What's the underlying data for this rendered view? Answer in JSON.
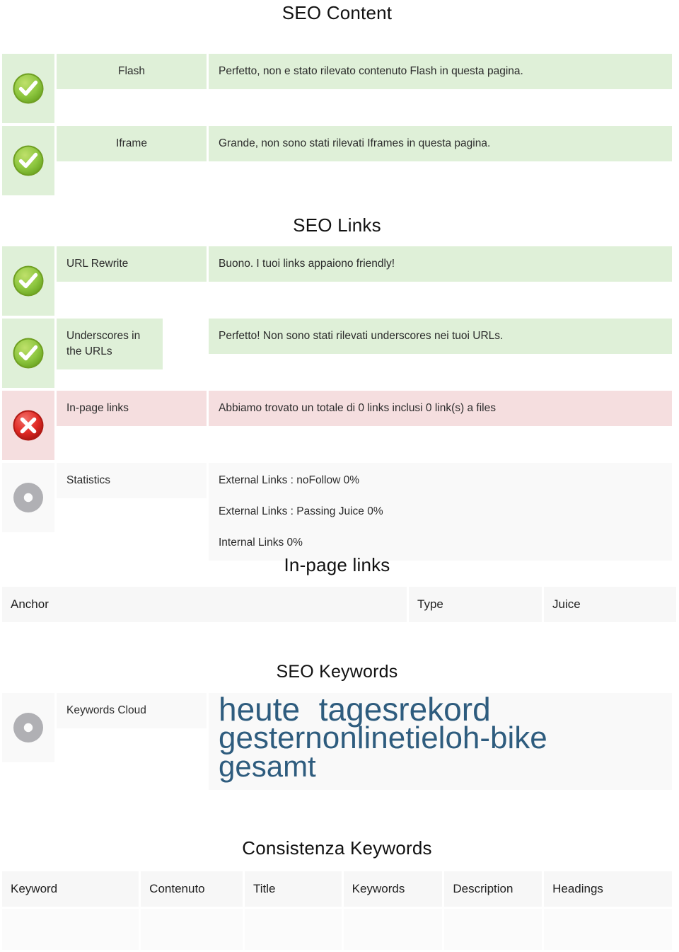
{
  "sections": {
    "seo_content": {
      "title": "SEO Content",
      "rows": [
        {
          "status": "ok",
          "icon": "green-check-icon",
          "label": "Flash",
          "text": "Perfetto, non e stato rilevato contenuto Flash in questa pagina."
        },
        {
          "status": "ok",
          "icon": "green-check-icon",
          "label": "Iframe",
          "text": "Grande, non sono stati rilevati Iframes in questa pagina."
        }
      ]
    },
    "seo_links": {
      "title": "SEO Links",
      "rows": [
        {
          "status": "ok",
          "icon": "green-check-icon",
          "label": "URL Rewrite",
          "text": "Buono. I tuoi links appaiono friendly!"
        },
        {
          "status": "ok",
          "icon": "green-check-icon",
          "label": "Underscores in the URLs",
          "text": "Perfetto! Non sono stati rilevati underscores nei tuoi URLs."
        },
        {
          "status": "error",
          "icon": "red-cross-icon",
          "label": "In-page links",
          "text": "Abbiamo trovato un totale di 0 links inclusi 0 link(s) a files"
        }
      ],
      "statistics": {
        "status": "info",
        "icon": "gray-donut-icon",
        "label": "Statistics",
        "lines": [
          "External Links : noFollow 0%",
          "External Links : Passing Juice 0%",
          "Internal Links 0%"
        ]
      }
    },
    "in_page_links": {
      "title": "In-page links",
      "columns": [
        "Anchor",
        "Type",
        "Juice"
      ],
      "rows": []
    },
    "seo_keywords": {
      "title": "SEO Keywords",
      "row": {
        "status": "info",
        "icon": "gray-donut-icon",
        "label": "Keywords Cloud",
        "cloud": [
          {
            "text": "heute",
            "size": "xl"
          },
          {
            "text": "tagesrekord",
            "size": "xl"
          },
          {
            "text": "gestern",
            "size": "lg"
          },
          {
            "text": "online",
            "size": "lg"
          },
          {
            "text": "tieloh-bike",
            "size": "lg"
          },
          {
            "text": "gesamt",
            "size": "md"
          }
        ]
      }
    },
    "consistenza_keywords": {
      "title": "Consistenza Keywords",
      "columns": [
        "Keyword",
        "Contenuto",
        "Title",
        "Keywords",
        "Description",
        "Headings"
      ],
      "rows": []
    }
  },
  "colors": {
    "ok_background": "#dff0d8",
    "error_background": "#f5dedf",
    "info_background": "#f9f9f9",
    "header_background": "#f7f7f7",
    "check_green": "#8cc63e",
    "cross_red": "#e03030",
    "donut_gray": "#b0b0b4",
    "cloud_blue": "#2e5c7e",
    "text": "#2b2b2b"
  }
}
